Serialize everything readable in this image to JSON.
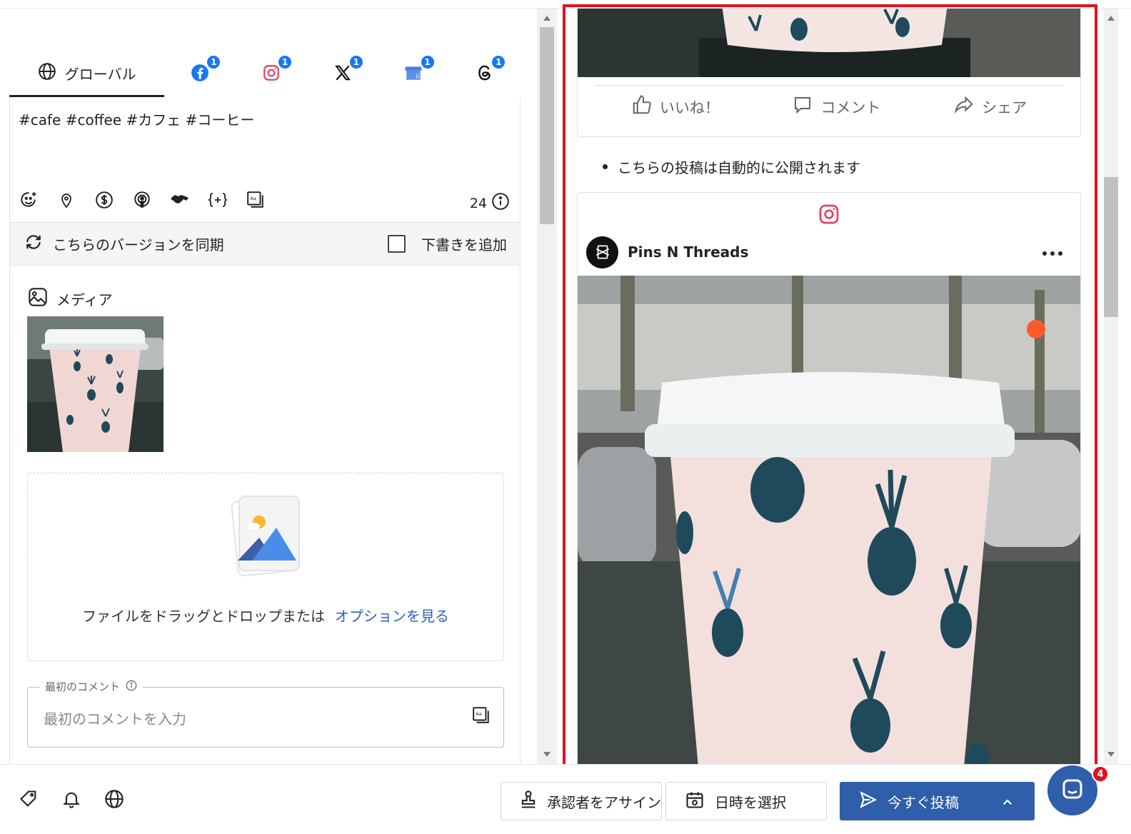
{
  "tabs": {
    "global_label": "グローバル",
    "networks": [
      {
        "name": "facebook",
        "badge": "1",
        "icon": "facebook-icon"
      },
      {
        "name": "instagram",
        "badge": "1",
        "icon": "instagram-icon"
      },
      {
        "name": "x",
        "badge": "1",
        "icon": "x-icon"
      },
      {
        "name": "google-business",
        "badge": "1",
        "icon": "google-business-icon"
      },
      {
        "name": "threads",
        "badge": "1",
        "icon": "threads-icon"
      }
    ]
  },
  "editor": {
    "text": "#cafe #coffee #カフェ #コーヒー",
    "char_count": "24",
    "tools": [
      "emoji-icon",
      "location-icon",
      "dollar-icon",
      "podcast-icon",
      "handshake-icon",
      "variable-icon",
      "caption-icon"
    ]
  },
  "sync": {
    "label": "こちらのバージョンを同期",
    "draft_label": "下書きを追加"
  },
  "media": {
    "label": "メディア",
    "drop_text": "ファイルをドラッグとドロップまたは",
    "drop_link": "オプションを見る"
  },
  "first_comment": {
    "label": "最初のコメント",
    "placeholder": "最初のコメントを入力"
  },
  "preview": {
    "fb_actions": {
      "like": "いいね！",
      "comment": "コメント",
      "share": "シェア"
    },
    "auto_publish_note": "こちらの投稿は自動的に公開されます",
    "ig_account": "Pins N Threads"
  },
  "bottom": {
    "assign_label": "承認者をアサイン",
    "date_label": "日時を選択",
    "post_label": "今すぐ投稿",
    "chat_badge": "4"
  },
  "colors": {
    "accent": "#2f5eab",
    "badge": "#1877f2",
    "highlight": "#e3101f",
    "link": "#2962c4"
  }
}
